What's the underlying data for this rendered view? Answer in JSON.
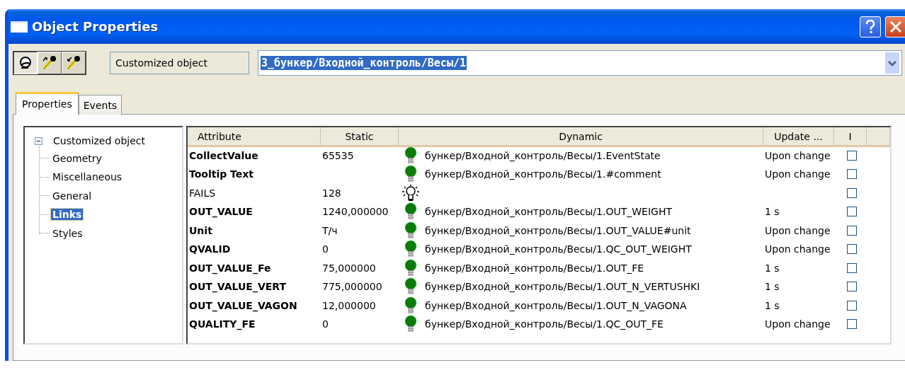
{
  "window": {
    "title": "Object Properties"
  },
  "toolbar": {
    "buttons": [
      {
        "pressed": true
      },
      {
        "pressed": false
      },
      {
        "pressed": false
      }
    ],
    "object_type": "Customized object",
    "object_path": "3_бункер/Входной_контроль/Весы/1"
  },
  "tabs": [
    {
      "label": "Properties",
      "selected": true
    },
    {
      "label": "Events",
      "selected": false
    }
  ],
  "tree": {
    "label": "Customized object",
    "expanded": true,
    "children": [
      {
        "label": "Geometry",
        "selected": false
      },
      {
        "label": "Miscellaneous",
        "selected": false
      },
      {
        "label": "General",
        "selected": false
      },
      {
        "label": "Links",
        "selected": true
      },
      {
        "label": "Styles",
        "selected": false
      }
    ]
  },
  "table": {
    "columns": [
      "Attribute",
      "Static",
      "Dynamic",
      "Update ...",
      "I"
    ],
    "rows": [
      {
        "attribute": "CollectValue",
        "bold": true,
        "static": "65535",
        "linked": true,
        "dynamic": "бункер/Входной_контроль/Весы/1.EventState",
        "update": "Upon change",
        "checked": false
      },
      {
        "attribute": "Tooltip Text",
        "bold": true,
        "linked": true,
        "dynamic": "бункер/Входной_контроль/Весы/1.#comment",
        "update": "Upon change",
        "checked": false
      },
      {
        "attribute": "FAILS",
        "bold": false,
        "static": "128",
        "linked": false,
        "checked": false
      },
      {
        "attribute": "OUT_VALUE",
        "bold": true,
        "static": "1240,000000",
        "linked": true,
        "dynamic": "бункер/Входной_контроль/Весы/1.OUT_WEIGHT",
        "update": "1 s",
        "checked": false
      },
      {
        "attribute": "Unit",
        "bold": true,
        "static": "Т/ч",
        "linked": true,
        "dynamic": "бункер/Входной_контроль/Весы/1.OUT_VALUE#unit",
        "update": "Upon change",
        "checked": false
      },
      {
        "attribute": "QVALID",
        "bold": true,
        "static": "0",
        "linked": true,
        "dynamic": "бункер/Входной_контроль/Весы/1.QC_OUT_WEIGHT",
        "update": "Upon change",
        "checked": false
      },
      {
        "attribute": "OUT_VALUE_Fe",
        "bold": true,
        "static": "75,000000",
        "linked": true,
        "dynamic": "бункер/Входной_контроль/Весы/1.OUT_FE",
        "update": "1 s",
        "checked": false
      },
      {
        "attribute": "OUT_VALUE_VERT",
        "bold": true,
        "static": "775,000000",
        "linked": true,
        "dynamic": "бункер/Входной_контроль/Весы/1.OUT_N_VERTUSHKI",
        "update": "1 s",
        "checked": false
      },
      {
        "attribute": "OUT_VALUE_VAGON",
        "bold": true,
        "static": "12,000000",
        "linked": true,
        "dynamic": "бункер/Входной_контроль/Весы/1.OUT_N_VAGONA",
        "update": "1 s",
        "checked": false
      },
      {
        "attribute": "QUALITY_FE",
        "bold": true,
        "static": "0",
        "linked": true,
        "dynamic": "бункер/Входной_контроль/Весы/1.QC_OUT_FE",
        "update": "Upon change",
        "checked": false
      }
    ]
  }
}
